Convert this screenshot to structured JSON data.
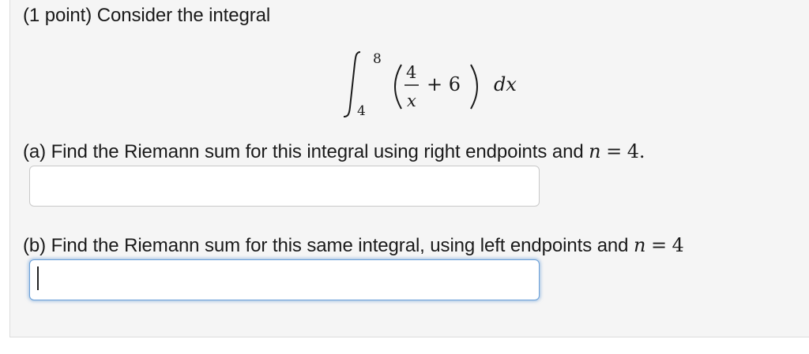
{
  "problem": {
    "intro": "(1 point) Consider the integral",
    "integral": {
      "upper": "8",
      "lower": "4",
      "numerator": "4",
      "denominator": "x",
      "plus_term": "+ 6",
      "differential": "dx"
    },
    "part_a": {
      "text": "(a) Find the Riemann sum for this integral using right endpoints and",
      "n_var": "n",
      "equals": "=",
      "n_value": "4."
    },
    "part_b": {
      "text": "(b) Find the Riemann sum for this same integral, using left endpoints and",
      "n_var": "n",
      "equals": "=",
      "n_value": "4"
    },
    "answer_a": {
      "value": "",
      "placeholder": ""
    },
    "answer_b": {
      "value": "",
      "placeholder": ""
    }
  }
}
